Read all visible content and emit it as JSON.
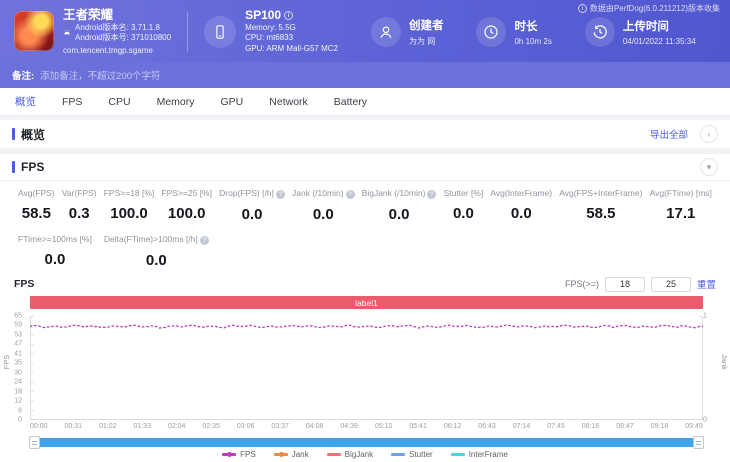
{
  "icons": {
    "info": "i",
    "question": "?",
    "chevron_left": "‹",
    "chevron_down": "▾"
  },
  "colors": {
    "accent_blue": "#4a5bdf",
    "header_gradient_start": "#7173dc",
    "header_gradient_end": "#5057cf",
    "note_bar_bg": "#6b70da",
    "scrollbar_blue": "#3ea4ee"
  },
  "header": {
    "collect_info": "数据由PerfDog(6.0.211212)版本收集",
    "app": {
      "name": "王者荣耀",
      "version_name": "Android版本名: 3.71.1.8",
      "version_code": "Android版本号: 371010800",
      "package": "com.tencent.tmgp.sgame"
    },
    "device": {
      "name": "SP100",
      "memory": "Memory: 5.5G",
      "cpu": "CPU: mt6833",
      "gpu": "GPU: ARM Mali-G57 MC2"
    },
    "creator": {
      "label": "创建者",
      "value": "为为 网"
    },
    "duration": {
      "label": "时长",
      "value": "0h 10m 2s"
    },
    "upload": {
      "label": "上传时间",
      "value": "04/01/2022 11:35:34"
    }
  },
  "note_bar": {
    "label": "备注:",
    "placeholder": "添加备注，不超过200个字符"
  },
  "tabs": [
    {
      "label": "概览",
      "active": true
    },
    {
      "label": "FPS",
      "active": false
    },
    {
      "label": "CPU",
      "active": false
    },
    {
      "label": "Memory",
      "active": false
    },
    {
      "label": "GPU",
      "active": false
    },
    {
      "label": "Network",
      "active": false
    },
    {
      "label": "Battery",
      "active": false
    }
  ],
  "overview": {
    "title": "概览",
    "export_label": "导出全部"
  },
  "fps_panel": {
    "title": "FPS",
    "stats_row1": [
      {
        "label": "Avg(FPS)",
        "value": "58.5",
        "info": false
      },
      {
        "label": "Var(FPS)",
        "value": "0.3",
        "info": false
      },
      {
        "label": "FPS>=18 [%]",
        "value": "100.0",
        "info": false
      },
      {
        "label": "FPS>=25 [%]",
        "value": "100.0",
        "info": false
      },
      {
        "label": "Drop(FPS) [/h]",
        "value": "0.0",
        "info": true
      },
      {
        "label": "Jank (/10min)",
        "value": "0.0",
        "info": true
      },
      {
        "label": "BigJank (/10min)",
        "value": "0.0",
        "info": true
      },
      {
        "label": "Stutter [%]",
        "value": "0.0",
        "info": false
      },
      {
        "label": "Avg(InterFrame)",
        "value": "0.0",
        "info": false
      },
      {
        "label": "Avg(FPS+InterFrame)",
        "value": "58.5",
        "info": false
      },
      {
        "label": "Avg(FTime) [ms]",
        "value": "17.1",
        "info": false
      }
    ],
    "stats_row2": [
      {
        "label": "FTime>=100ms [%]",
        "value": "0.0",
        "info": false
      },
      {
        "label": "Delta(FTime)>100ms [/h]",
        "value": "0.0",
        "info": true
      }
    ],
    "threshold": {
      "label": "FPS(>=)",
      "value1": "18",
      "value2": "25",
      "reset_label": "重置"
    }
  },
  "chart_data": {
    "type": "line",
    "title": "FPS",
    "band_label": "label1",
    "band_color": "#e85c6c",
    "ylabel_left": "FPS",
    "ylabel_right": "Jank",
    "ylim_left": [
      0,
      65
    ],
    "ylim_right": [
      0,
      1
    ],
    "y_ticks_left": [
      65,
      59,
      53,
      47,
      41,
      35,
      30,
      24,
      18,
      12,
      6,
      0
    ],
    "y_ticks_right": [
      1,
      0
    ],
    "x_ticks": [
      "00:00",
      "00:31",
      "01:02",
      "01:33",
      "02:04",
      "02:35",
      "03:06",
      "03:37",
      "04:08",
      "04:39",
      "05:10",
      "05:41",
      "06:12",
      "06:43",
      "07:14",
      "07:45",
      "08:16",
      "08:47",
      "09:18",
      "09:49"
    ],
    "series": [
      {
        "name": "FPS",
        "color": "#c637be",
        "marker": true,
        "avg": 58.5,
        "visible": true
      },
      {
        "name": "Jank",
        "color": "#ef8a43",
        "marker": true,
        "avg": 0,
        "visible": false
      },
      {
        "name": "BigJank",
        "color": "#f07070",
        "marker": false,
        "avg": 0,
        "visible": false
      },
      {
        "name": "Stutter",
        "color": "#6da3e8",
        "marker": false,
        "avg": 0,
        "visible": false
      },
      {
        "name": "InterFrame",
        "color": "#49d6de",
        "marker": false,
        "avg": 0,
        "visible": false
      }
    ]
  }
}
